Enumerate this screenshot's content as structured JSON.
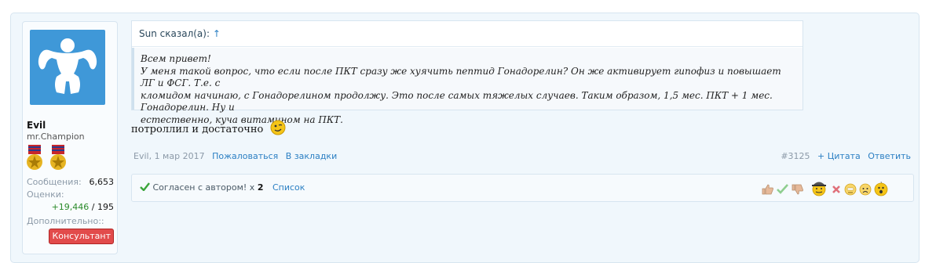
{
  "user": {
    "name": "Evil",
    "title": "mr.Champion",
    "stats": {
      "messages_label": "Сообщения:",
      "messages_value": "6,653",
      "ratings_label": "Оценки:",
      "ratings_positive": "+19,446",
      "ratings_separator": "/",
      "ratings_total": "195",
      "extra_label": "Дополнительно::"
    },
    "badge": "Консультант"
  },
  "quote": {
    "author_line": "Sun сказал(а):",
    "arrow": "↑",
    "text_lines": [
      "Всем привет!",
      "У меня такой вопрос, что если после ПКТ сразу же хуячить пептид Гонадорелин? Он же активирует гипофиз и повышает ЛГ и ФСГ. Т.е. с",
      "кломидом начинаю, с Гонадорелином продолжу. Это после самых тяжелых случаев. Таким образом, 1,5 мес. ПКТ + 1 мес. Гонадорелин. Ну и",
      "естественно, куча витамином на ПКТ."
    ]
  },
  "message": {
    "text": "потроллил и достаточно"
  },
  "meta": {
    "author_date": "Evil, 1 мар 2017",
    "report": "Пожаловаться",
    "bookmark": "В закладки",
    "post_number": "#3125",
    "quote_action": "+ Цитата",
    "reply": "Ответить"
  },
  "likes": {
    "summary": "Согласен с автором! x",
    "count": "2",
    "list_link": "Список"
  },
  "colors": {
    "accent_link": "#2b7fc3",
    "avatar_bg": "#3f98d8",
    "badge_bg": "#e24b4b",
    "positive": "#2a8a2a"
  },
  "icons": [
    "bodybuilder-avatar",
    "medal-icon",
    "smile-emoji",
    "check-icon",
    "thumbs-up-icon",
    "thumbs-down-icon",
    "cross-icon"
  ]
}
